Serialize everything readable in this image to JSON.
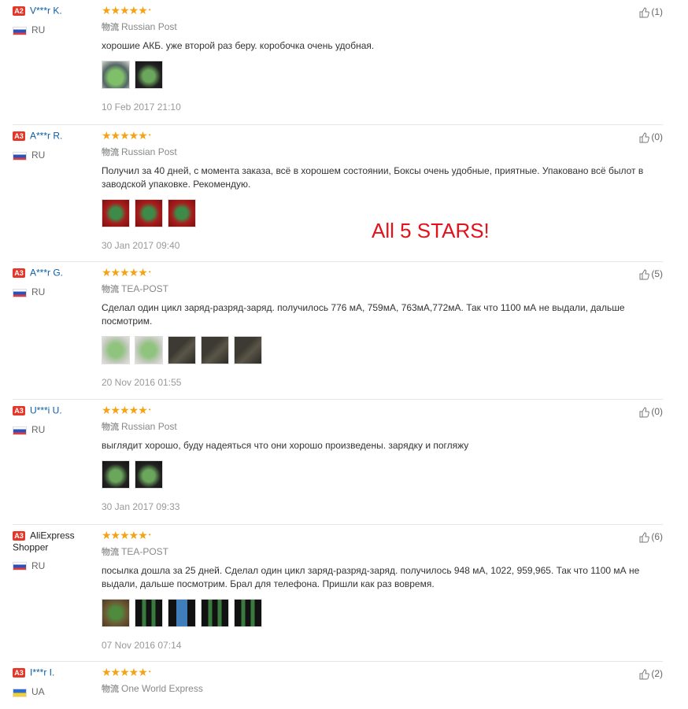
{
  "banner": "All 5 STARS!",
  "reviews": [
    {
      "badge": "A2",
      "user": "V***r K.",
      "country": "RU",
      "flag": "ru",
      "stars": "★★★★★",
      "shipping": "Russian Post",
      "text": "хорошие АКБ. уже второй раз беру. коробочка очень удобная.",
      "photos": [
        "t-green",
        "t-dark"
      ],
      "date": "10 Feb 2017 21:10",
      "likes": "(1)"
    },
    {
      "badge": "A3",
      "user": "A***r R.",
      "country": "RU",
      "flag": "ru",
      "stars": "★★★★★",
      "shipping": "Russian Post",
      "text": "Получил за 40 дней, с момента заказа, всё в хорошем состоянии, Боксы очень удобные, приятные. Упаковано всё былот в заводской упаковке. Рекомендую.",
      "photos": [
        "t-red",
        "t-red",
        "t-red"
      ],
      "date": "30 Jan 2017 09:40",
      "likes": "(0)"
    },
    {
      "badge": "A3",
      "user": "A***r G.",
      "country": "RU",
      "flag": "ru",
      "stars": "★★★★★",
      "shipping": "TEA-POST",
      "text": "Сделал один цикл заряд-разряд-заряд. получилось 776 мА, 759мА, 763мА,772мА. Так что 1100 мА не выдали, дальше посмотрим.",
      "photos": [
        "t-light",
        "t-light",
        "t-charger",
        "t-charger",
        "t-charger"
      ],
      "date": "20 Nov 2016 01:55",
      "likes": "(5)"
    },
    {
      "badge": "A3",
      "user": "U***i U.",
      "country": "RU",
      "flag": "ru",
      "stars": "★★★★★",
      "shipping": "Russian Post",
      "text": "выглядит хорошо, буду надеяться что они хорошо произведены. зарядку и погляжу",
      "photos": [
        "t-dark",
        "t-dark"
      ],
      "date": "30 Jan 2017 09:33",
      "likes": "(0)"
    },
    {
      "badge": "A3",
      "user": "AliExpress Shopper",
      "country": "RU",
      "flag": "ru",
      "stars": "★★★★★",
      "shipping": "TEA-POST",
      "text": "посылка дошла за 25 дней. Сделал один цикл заряд-разряд-заряд. получилось 948 мА, 1022, 959,965. Так что 1100 мА не выдали, дальше посмотрим. Брал для телефона. Пришли как раз вовремя.",
      "photos": [
        "t-brown",
        "t-black",
        "t-blue",
        "t-black",
        "t-black"
      ],
      "date": "07 Nov 2016 07:14",
      "likes": "(6)"
    },
    {
      "badge": "A3",
      "user": "I***r I.",
      "country": "UA",
      "flag": "ua",
      "stars": "★★★★★",
      "shipping": "One World Express",
      "text": "",
      "photos": [],
      "date": "",
      "likes": "(2)"
    }
  ]
}
